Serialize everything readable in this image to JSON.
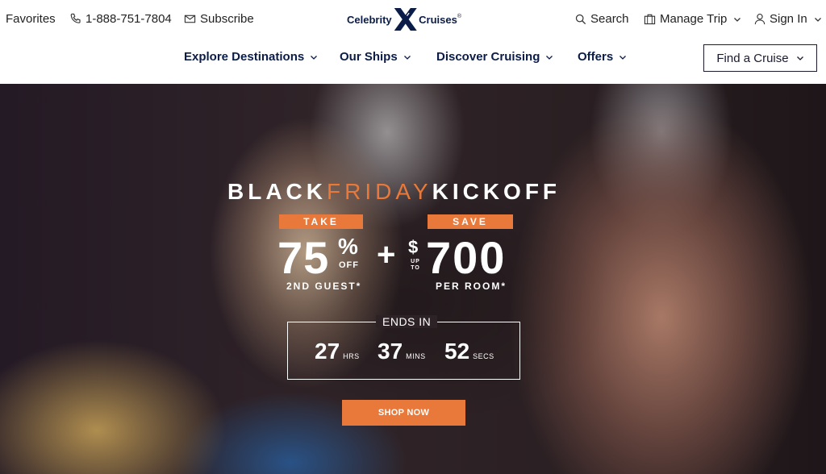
{
  "utility": {
    "favorites": "Favorites",
    "phone": "1-888-751-7804",
    "subscribe": "Subscribe",
    "search": "Search",
    "manage_trip": "Manage Trip",
    "sign_in": "Sign In"
  },
  "logo": {
    "left_word": "Celebrity",
    "right_word": "Cruises",
    "mark": "X",
    "reg": "®"
  },
  "nav": {
    "items": [
      {
        "label": "Explore Destinations"
      },
      {
        "label": "Our Ships"
      },
      {
        "label": "Discover Cruising"
      },
      {
        "label": "Offers"
      }
    ],
    "find_cruise": "Find a Cruise"
  },
  "hero": {
    "headline": {
      "part1": "BLACK",
      "part2": "FRIDAY",
      "part3": "KICKOFF"
    },
    "offer1": {
      "tag": "TAKE",
      "value": "75",
      "symbol": "%",
      "suffix": "OFF",
      "caption": "2ND GUEST*"
    },
    "plus": "+",
    "offer2": {
      "tag": "SAVE",
      "currency": "$",
      "prefix_top": "UP",
      "prefix_bottom": "TO",
      "value": "700",
      "caption": "PER ROOM*"
    },
    "countdown": {
      "label": "ENDS IN",
      "hours": "27",
      "hours_label": "HRS",
      "minutes": "37",
      "minutes_label": "MINS",
      "seconds": "52",
      "seconds_label": "SECS"
    },
    "cta": "SHOP NOW"
  },
  "colors": {
    "brand_navy": "#0b1c48",
    "accent_orange": "#e8793a"
  }
}
